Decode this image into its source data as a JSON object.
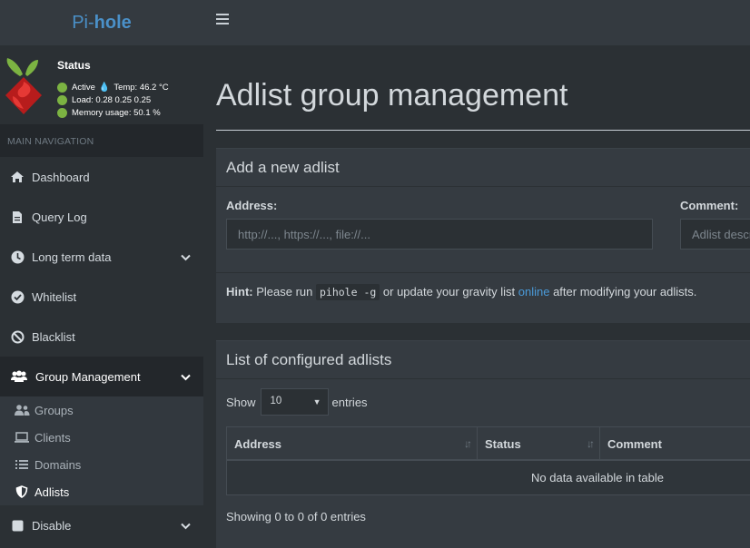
{
  "brand": {
    "prefix": "Pi-",
    "suffix": "hole"
  },
  "status": {
    "title": "Status",
    "active": "Active",
    "temp": "Temp: 46.2 °C",
    "load": "Load:  0.28  0.25  0.25",
    "memory": "Memory usage:  50.1 %"
  },
  "nav": {
    "header": "MAIN NAVIGATION",
    "dashboard": "Dashboard",
    "query_log": "Query Log",
    "long_term": "Long term data",
    "whitelist": "Whitelist",
    "blacklist": "Blacklist",
    "group_management": "Group Management",
    "groups": "Groups",
    "clients": "Clients",
    "domains": "Domains",
    "adlists": "Adlists",
    "disable": "Disable"
  },
  "page": {
    "title": "Adlist group management"
  },
  "add_box": {
    "title": "Add a new adlist",
    "address_label": "Address:",
    "address_placeholder": "http://..., https://..., file://...",
    "comment_label": "Comment:",
    "comment_placeholder": "Adlist description",
    "hint_label": "Hint:",
    "hint_text_1": " Please run ",
    "hint_code": "pihole -g",
    "hint_text_2": " or update your gravity list ",
    "hint_link": "online",
    "hint_text_3": " after modifying your adlists."
  },
  "list_box": {
    "title": "List of configured adlists",
    "show_label": "Show",
    "page_size": "10",
    "entries_label": "entries",
    "columns": [
      "Address",
      "Status",
      "Comment"
    ],
    "empty_text": "No data available in table",
    "info_text": "Showing 0 to 0 of 0 entries"
  },
  "colors": {
    "accent": "#4a90c8",
    "status_green": "#7cb342",
    "sidebar_bg": "#2b3034",
    "topbar_bg": "#343a40"
  }
}
